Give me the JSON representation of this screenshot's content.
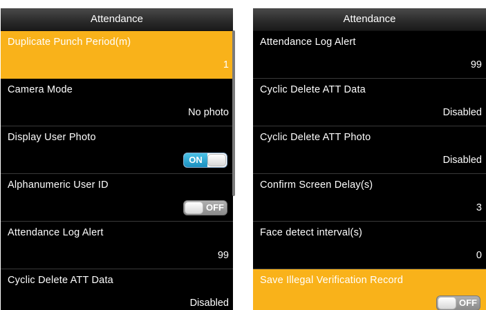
{
  "colors": {
    "selected": "#f9b21a",
    "background": "#000000",
    "toggle_on": "#1b8fc0"
  },
  "left": {
    "title": "Attendance",
    "items": [
      {
        "label": "Duplicate Punch Period(m)",
        "value": "1",
        "selected": true
      },
      {
        "label": "Camera Mode",
        "value": "No photo"
      },
      {
        "label": "Display User Photo",
        "toggle": "ON"
      },
      {
        "label": "Alphanumeric User ID",
        "toggle": "OFF"
      },
      {
        "label": "Attendance Log Alert",
        "value": "99"
      },
      {
        "label": "Cyclic Delete ATT Data",
        "value": "Disabled"
      }
    ]
  },
  "right": {
    "title": "Attendance",
    "items": [
      {
        "label": "Attendance Log Alert",
        "value": "99"
      },
      {
        "label": "Cyclic Delete ATT Data",
        "value": "Disabled"
      },
      {
        "label": "Cyclic Delete ATT Photo",
        "value": "Disabled"
      },
      {
        "label": "Confirm Screen Delay(s)",
        "value": "3"
      },
      {
        "label": "Face detect interval(s)",
        "value": "0"
      },
      {
        "label": "Save Illegal Verification Record",
        "toggle": "OFF",
        "selected": true
      }
    ]
  }
}
